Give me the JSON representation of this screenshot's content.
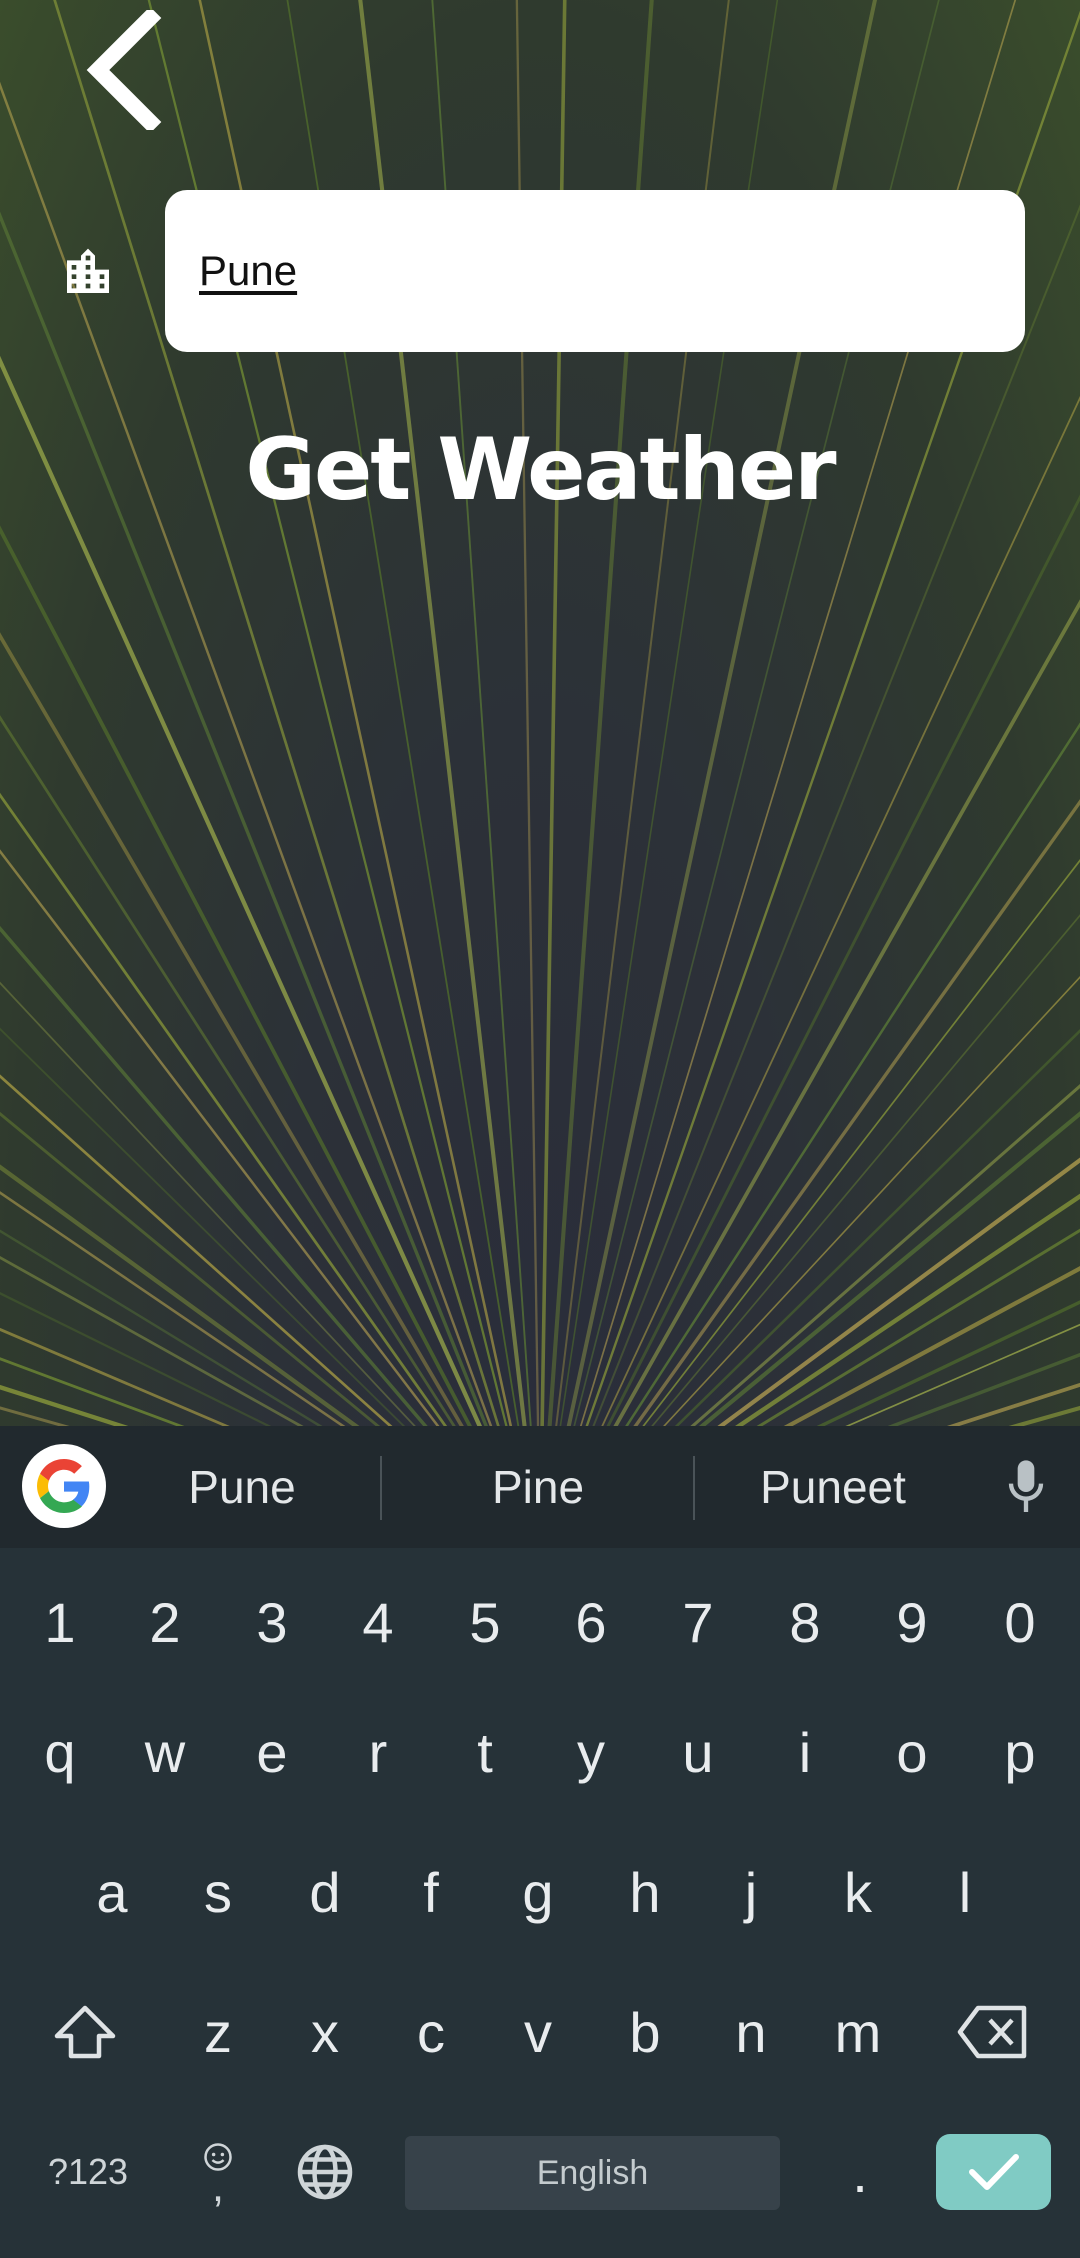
{
  "app": {
    "back_icon": "chevron-left-icon",
    "city_icon": "city-buildings-icon",
    "city_input_value": "Pune",
    "get_weather_label": "Get Weather"
  },
  "keyboard": {
    "suggestions": [
      "Pune",
      "Pine",
      "Puneet"
    ],
    "number_row": [
      "1",
      "2",
      "3",
      "4",
      "5",
      "6",
      "7",
      "8",
      "9",
      "0"
    ],
    "row1": [
      "q",
      "w",
      "e",
      "r",
      "t",
      "y",
      "u",
      "i",
      "o",
      "p"
    ],
    "row2": [
      "a",
      "s",
      "d",
      "f",
      "g",
      "h",
      "j",
      "k",
      "l"
    ],
    "row3": [
      "z",
      "x",
      "c",
      "v",
      "b",
      "n",
      "m"
    ],
    "symbols_label": "?123",
    "comma_label": ",",
    "period_label": ".",
    "space_label": "English",
    "accent_color": "#80cbc4"
  }
}
